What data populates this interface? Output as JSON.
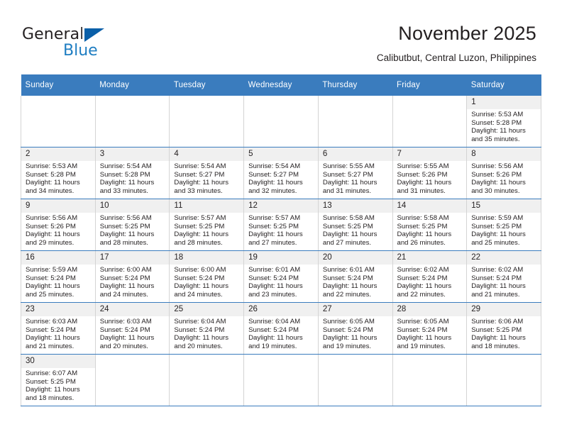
{
  "brand": {
    "name_top": "General",
    "name_bottom": "Blue",
    "accent_color": "#1f7ec2",
    "triangle_color": "#0a5fa8"
  },
  "header": {
    "title": "November 2025",
    "subtitle": "Calibutbut, Central Luzon, Philippines"
  },
  "calendar": {
    "header_bg": "#3a7cbe",
    "daynum_bg": "#f0f0f0",
    "weekdays": [
      "Sunday",
      "Monday",
      "Tuesday",
      "Wednesday",
      "Thursday",
      "Friday",
      "Saturday"
    ],
    "weeks": [
      [
        {
          "day": "",
          "sunrise": "",
          "sunset": "",
          "daylight_1": "",
          "daylight_2": ""
        },
        {
          "day": "",
          "sunrise": "",
          "sunset": "",
          "daylight_1": "",
          "daylight_2": ""
        },
        {
          "day": "",
          "sunrise": "",
          "sunset": "",
          "daylight_1": "",
          "daylight_2": ""
        },
        {
          "day": "",
          "sunrise": "",
          "sunset": "",
          "daylight_1": "",
          "daylight_2": ""
        },
        {
          "day": "",
          "sunrise": "",
          "sunset": "",
          "daylight_1": "",
          "daylight_2": ""
        },
        {
          "day": "",
          "sunrise": "",
          "sunset": "",
          "daylight_1": "",
          "daylight_2": ""
        },
        {
          "day": "1",
          "sunrise": "Sunrise: 5:53 AM",
          "sunset": "Sunset: 5:28 PM",
          "daylight_1": "Daylight: 11 hours",
          "daylight_2": "and 35 minutes."
        }
      ],
      [
        {
          "day": "2",
          "sunrise": "Sunrise: 5:53 AM",
          "sunset": "Sunset: 5:28 PM",
          "daylight_1": "Daylight: 11 hours",
          "daylight_2": "and 34 minutes."
        },
        {
          "day": "3",
          "sunrise": "Sunrise: 5:54 AM",
          "sunset": "Sunset: 5:28 PM",
          "daylight_1": "Daylight: 11 hours",
          "daylight_2": "and 33 minutes."
        },
        {
          "day": "4",
          "sunrise": "Sunrise: 5:54 AM",
          "sunset": "Sunset: 5:27 PM",
          "daylight_1": "Daylight: 11 hours",
          "daylight_2": "and 33 minutes."
        },
        {
          "day": "5",
          "sunrise": "Sunrise: 5:54 AM",
          "sunset": "Sunset: 5:27 PM",
          "daylight_1": "Daylight: 11 hours",
          "daylight_2": "and 32 minutes."
        },
        {
          "day": "6",
          "sunrise": "Sunrise: 5:55 AM",
          "sunset": "Sunset: 5:27 PM",
          "daylight_1": "Daylight: 11 hours",
          "daylight_2": "and 31 minutes."
        },
        {
          "day": "7",
          "sunrise": "Sunrise: 5:55 AM",
          "sunset": "Sunset: 5:26 PM",
          "daylight_1": "Daylight: 11 hours",
          "daylight_2": "and 31 minutes."
        },
        {
          "day": "8",
          "sunrise": "Sunrise: 5:56 AM",
          "sunset": "Sunset: 5:26 PM",
          "daylight_1": "Daylight: 11 hours",
          "daylight_2": "and 30 minutes."
        }
      ],
      [
        {
          "day": "9",
          "sunrise": "Sunrise: 5:56 AM",
          "sunset": "Sunset: 5:26 PM",
          "daylight_1": "Daylight: 11 hours",
          "daylight_2": "and 29 minutes."
        },
        {
          "day": "10",
          "sunrise": "Sunrise: 5:56 AM",
          "sunset": "Sunset: 5:25 PM",
          "daylight_1": "Daylight: 11 hours",
          "daylight_2": "and 28 minutes."
        },
        {
          "day": "11",
          "sunrise": "Sunrise: 5:57 AM",
          "sunset": "Sunset: 5:25 PM",
          "daylight_1": "Daylight: 11 hours",
          "daylight_2": "and 28 minutes."
        },
        {
          "day": "12",
          "sunrise": "Sunrise: 5:57 AM",
          "sunset": "Sunset: 5:25 PM",
          "daylight_1": "Daylight: 11 hours",
          "daylight_2": "and 27 minutes."
        },
        {
          "day": "13",
          "sunrise": "Sunrise: 5:58 AM",
          "sunset": "Sunset: 5:25 PM",
          "daylight_1": "Daylight: 11 hours",
          "daylight_2": "and 27 minutes."
        },
        {
          "day": "14",
          "sunrise": "Sunrise: 5:58 AM",
          "sunset": "Sunset: 5:25 PM",
          "daylight_1": "Daylight: 11 hours",
          "daylight_2": "and 26 minutes."
        },
        {
          "day": "15",
          "sunrise": "Sunrise: 5:59 AM",
          "sunset": "Sunset: 5:25 PM",
          "daylight_1": "Daylight: 11 hours",
          "daylight_2": "and 25 minutes."
        }
      ],
      [
        {
          "day": "16",
          "sunrise": "Sunrise: 5:59 AM",
          "sunset": "Sunset: 5:24 PM",
          "daylight_1": "Daylight: 11 hours",
          "daylight_2": "and 25 minutes."
        },
        {
          "day": "17",
          "sunrise": "Sunrise: 6:00 AM",
          "sunset": "Sunset: 5:24 PM",
          "daylight_1": "Daylight: 11 hours",
          "daylight_2": "and 24 minutes."
        },
        {
          "day": "18",
          "sunrise": "Sunrise: 6:00 AM",
          "sunset": "Sunset: 5:24 PM",
          "daylight_1": "Daylight: 11 hours",
          "daylight_2": "and 24 minutes."
        },
        {
          "day": "19",
          "sunrise": "Sunrise: 6:01 AM",
          "sunset": "Sunset: 5:24 PM",
          "daylight_1": "Daylight: 11 hours",
          "daylight_2": "and 23 minutes."
        },
        {
          "day": "20",
          "sunrise": "Sunrise: 6:01 AM",
          "sunset": "Sunset: 5:24 PM",
          "daylight_1": "Daylight: 11 hours",
          "daylight_2": "and 22 minutes."
        },
        {
          "day": "21",
          "sunrise": "Sunrise: 6:02 AM",
          "sunset": "Sunset: 5:24 PM",
          "daylight_1": "Daylight: 11 hours",
          "daylight_2": "and 22 minutes."
        },
        {
          "day": "22",
          "sunrise": "Sunrise: 6:02 AM",
          "sunset": "Sunset: 5:24 PM",
          "daylight_1": "Daylight: 11 hours",
          "daylight_2": "and 21 minutes."
        }
      ],
      [
        {
          "day": "23",
          "sunrise": "Sunrise: 6:03 AM",
          "sunset": "Sunset: 5:24 PM",
          "daylight_1": "Daylight: 11 hours",
          "daylight_2": "and 21 minutes."
        },
        {
          "day": "24",
          "sunrise": "Sunrise: 6:03 AM",
          "sunset": "Sunset: 5:24 PM",
          "daylight_1": "Daylight: 11 hours",
          "daylight_2": "and 20 minutes."
        },
        {
          "day": "25",
          "sunrise": "Sunrise: 6:04 AM",
          "sunset": "Sunset: 5:24 PM",
          "daylight_1": "Daylight: 11 hours",
          "daylight_2": "and 20 minutes."
        },
        {
          "day": "26",
          "sunrise": "Sunrise: 6:04 AM",
          "sunset": "Sunset: 5:24 PM",
          "daylight_1": "Daylight: 11 hours",
          "daylight_2": "and 19 minutes."
        },
        {
          "day": "27",
          "sunrise": "Sunrise: 6:05 AM",
          "sunset": "Sunset: 5:24 PM",
          "daylight_1": "Daylight: 11 hours",
          "daylight_2": "and 19 minutes."
        },
        {
          "day": "28",
          "sunrise": "Sunrise: 6:05 AM",
          "sunset": "Sunset: 5:24 PM",
          "daylight_1": "Daylight: 11 hours",
          "daylight_2": "and 19 minutes."
        },
        {
          "day": "29",
          "sunrise": "Sunrise: 6:06 AM",
          "sunset": "Sunset: 5:25 PM",
          "daylight_1": "Daylight: 11 hours",
          "daylight_2": "and 18 minutes."
        }
      ],
      [
        {
          "day": "30",
          "sunrise": "Sunrise: 6:07 AM",
          "sunset": "Sunset: 5:25 PM",
          "daylight_1": "Daylight: 11 hours",
          "daylight_2": "and 18 minutes."
        },
        {
          "day": "",
          "sunrise": "",
          "sunset": "",
          "daylight_1": "",
          "daylight_2": ""
        },
        {
          "day": "",
          "sunrise": "",
          "sunset": "",
          "daylight_1": "",
          "daylight_2": ""
        },
        {
          "day": "",
          "sunrise": "",
          "sunset": "",
          "daylight_1": "",
          "daylight_2": ""
        },
        {
          "day": "",
          "sunrise": "",
          "sunset": "",
          "daylight_1": "",
          "daylight_2": ""
        },
        {
          "day": "",
          "sunrise": "",
          "sunset": "",
          "daylight_1": "",
          "daylight_2": ""
        },
        {
          "day": "",
          "sunrise": "",
          "sunset": "",
          "daylight_1": "",
          "daylight_2": ""
        }
      ]
    ]
  }
}
